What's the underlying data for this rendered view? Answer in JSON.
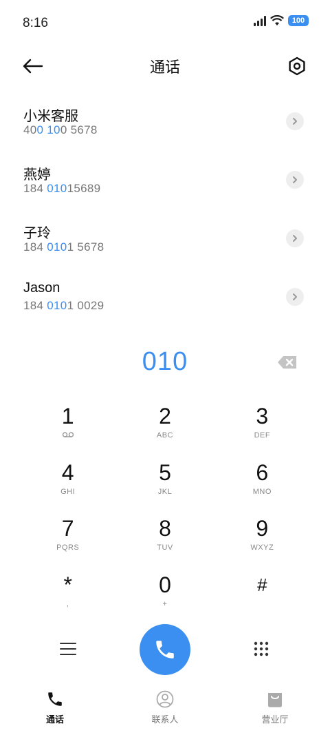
{
  "status_bar": {
    "time": "8:16",
    "battery": "100"
  },
  "header": {
    "title": "通话"
  },
  "contacts": [
    {
      "name": "小米客服",
      "number_parts": [
        "40",
        "0 10",
        "0 5678"
      ]
    },
    {
      "name": "燕婷",
      "number_parts": [
        "184 ",
        "010",
        "15689"
      ]
    },
    {
      "name": "子玲",
      "number_parts": [
        "184 ",
        "010",
        "1 5678"
      ]
    },
    {
      "name": "Jason",
      "number_parts": [
        "184 ",
        "010",
        "1 0029"
      ]
    }
  ],
  "dialer": {
    "input": "010"
  },
  "keypad": [
    {
      "digit": "1",
      "letters": ""
    },
    {
      "digit": "2",
      "letters": "ABC"
    },
    {
      "digit": "3",
      "letters": "DEF"
    },
    {
      "digit": "4",
      "letters": "GHI"
    },
    {
      "digit": "5",
      "letters": "JKL"
    },
    {
      "digit": "6",
      "letters": "MNO"
    },
    {
      "digit": "7",
      "letters": "PQRS"
    },
    {
      "digit": "8",
      "letters": "TUV"
    },
    {
      "digit": "9",
      "letters": "WXYZ"
    },
    {
      "digit": "*",
      "letters": ","
    },
    {
      "digit": "0",
      "letters": "+"
    },
    {
      "digit": "#",
      "letters": ""
    }
  ],
  "bottom_nav": [
    {
      "label": "通话",
      "icon": "phone-icon",
      "active": true
    },
    {
      "label": "联系人",
      "icon": "person-icon",
      "active": false
    },
    {
      "label": "营业厅",
      "icon": "shopping-bag-icon",
      "active": false
    }
  ],
  "colors": {
    "accent": "#3a8ff0",
    "text": "#111111",
    "secondary": "#777777"
  }
}
